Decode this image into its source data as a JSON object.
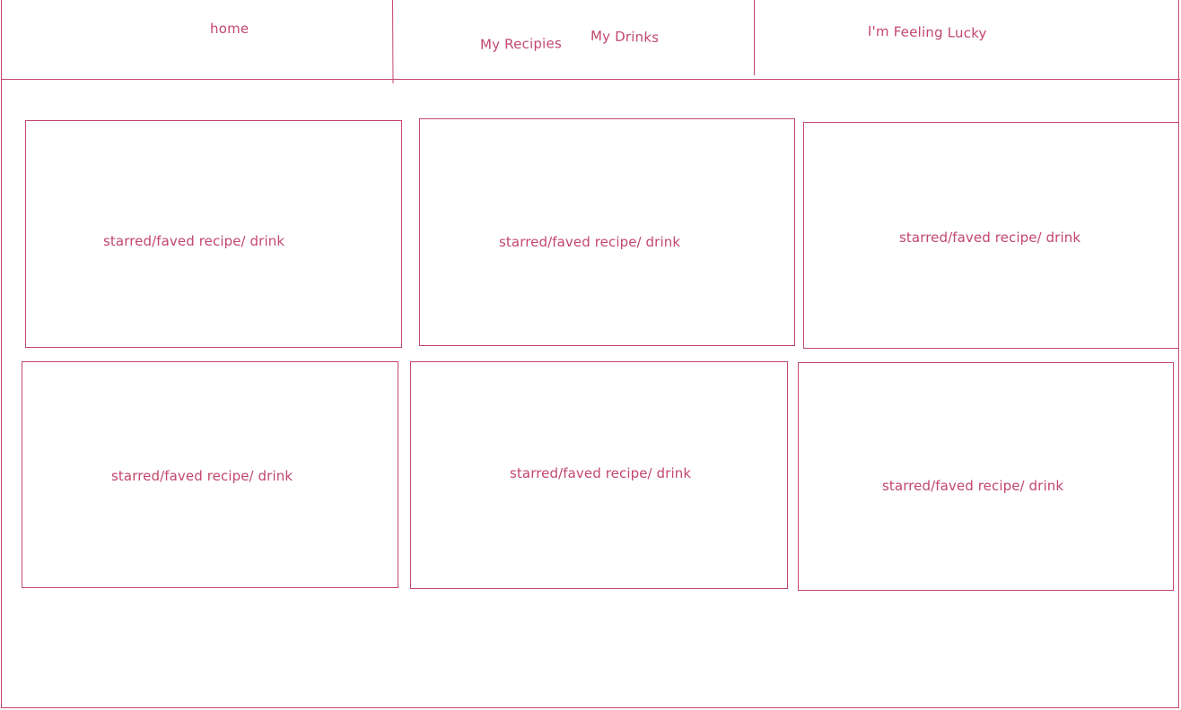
{
  "nav": {
    "home": "home",
    "my_recipes": "My Recipies",
    "my_drinks": "My Drinks",
    "feeling_lucky": "I'm Feeling Lucky"
  },
  "cards": [
    {
      "label": "starred/faved recipe/ drink"
    },
    {
      "label": "starred/faved recipe/ drink"
    },
    {
      "label": "starred/faved recipe/ drink"
    },
    {
      "label": "starred/faved recipe/ drink"
    },
    {
      "label": "starred/faved recipe/ drink"
    },
    {
      "label": "starred/faved recipe/ drink"
    }
  ],
  "colors": {
    "sketch_stroke": "#c2476c",
    "background": "#ffffff"
  }
}
